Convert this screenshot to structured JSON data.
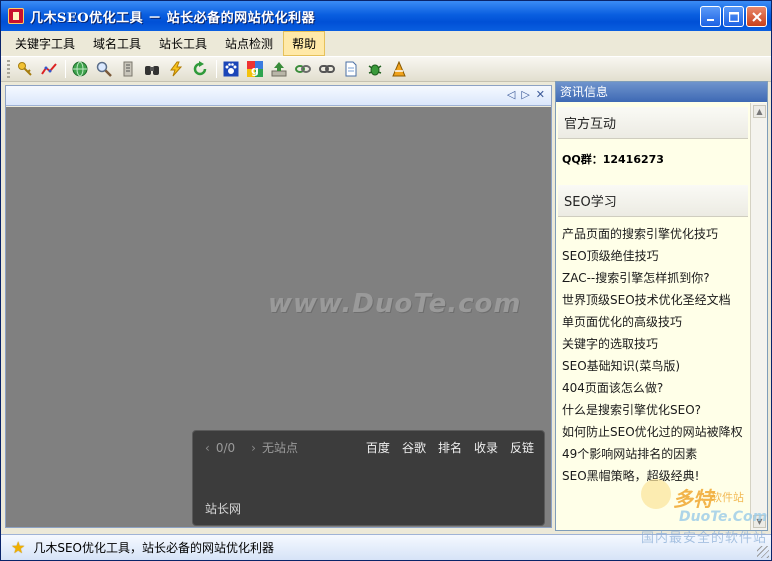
{
  "window": {
    "title": "几木SEO优化工具 － 站长必备的网站优化利器"
  },
  "menu": {
    "items": [
      {
        "label": "关键字工具"
      },
      {
        "label": "域名工具"
      },
      {
        "label": "站长工具"
      },
      {
        "label": "站点检测"
      },
      {
        "label": "帮助",
        "active": true
      }
    ]
  },
  "toolbar": {
    "icons": [
      "key-icon",
      "trend-icon",
      "globe-icon",
      "magnifier-icon",
      "list-icon",
      "binoculars-icon",
      "lightning-icon",
      "refresh-icon",
      "paw-icon",
      "google-icon",
      "upload-icon",
      "chain-icon",
      "link-icon",
      "document-icon",
      "bug-icon",
      "cone-icon"
    ]
  },
  "main": {
    "nav_prev": "◁",
    "nav_next": "▷",
    "nav_close": "✕",
    "watermark": "www.DuoTe.com",
    "bottom_panel": {
      "counter": "0/0",
      "site": "无站点",
      "links": [
        "百度",
        "谷歌",
        "排名",
        "收录",
        "反链"
      ],
      "footer": "站长网"
    }
  },
  "side": {
    "header": "资讯信息",
    "official": {
      "title": "官方互动",
      "qq": "QQ群：12416273"
    },
    "seo": {
      "title": "SEO学习",
      "links": [
        "产品页面的搜索引擎优化技巧",
        "SEO顶级绝佳技巧",
        "ZAC--搜索引擎怎样抓到你?",
        "世界顶级SEO技术优化圣经文档",
        "单页面优化的高级技巧",
        "关键字的选取技巧",
        "SEO基础知识(菜鸟版)",
        "404页面该怎么做?",
        "什么是搜索引擎优化SEO?",
        "如何防止SEO优化过的网站被降权",
        "49个影响网站排名的因素",
        "SEO黑帽策略，超级经典!"
      ]
    }
  },
  "status": {
    "text": "几木SEO优化工具，站长必备的网站优化利器"
  },
  "corner_logo": {
    "brand": "多特",
    "tag": "软件站",
    "site": "DuoTe.Com",
    "slogan": "国内最安全的软件站"
  }
}
